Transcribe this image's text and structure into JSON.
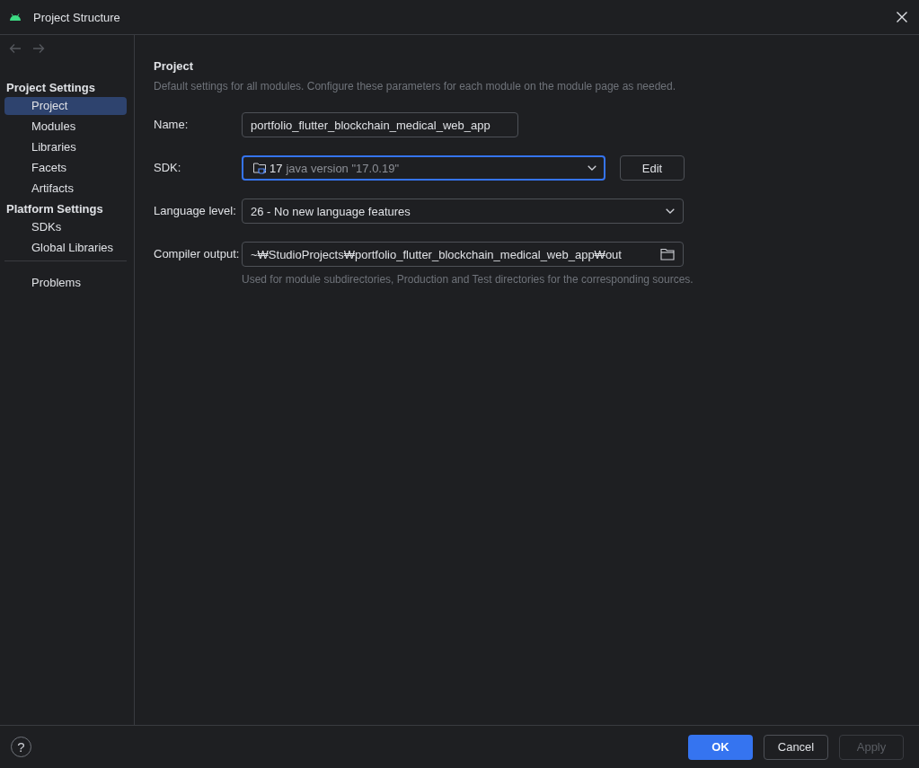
{
  "window": {
    "title": "Project Structure"
  },
  "navigation": [
    {
      "kind": "back",
      "disabled": true
    },
    {
      "kind": "forward",
      "disabled": true
    }
  ],
  "sidebar": {
    "groups": [
      {
        "heading": "Project Settings",
        "items": [
          {
            "label": "Project",
            "selected": true
          },
          {
            "label": "Modules",
            "selected": false
          },
          {
            "label": "Libraries",
            "selected": false
          },
          {
            "label": "Facets",
            "selected": false
          },
          {
            "label": "Artifacts",
            "selected": false
          }
        ]
      },
      {
        "heading": "Platform Settings",
        "items": [
          {
            "label": "SDKs",
            "selected": false
          },
          {
            "label": "Global Libraries",
            "selected": false
          }
        ]
      },
      {
        "items": [
          {
            "label": "Problems",
            "selected": false
          }
        ]
      }
    ]
  },
  "panel": {
    "title": "Project",
    "description": "Default settings for all modules. Configure these parameters for each module on the module page as needed.",
    "fields": [
      {
        "kind": "text",
        "label": "Name:",
        "value": "portfolio_flutter_blockchain_medical_web_app"
      },
      {
        "kind": "combo",
        "label": "SDK:",
        "value": "17",
        "detail": "java version \"17.0.19\"",
        "focused": true,
        "button": "Edit"
      },
      {
        "kind": "combo",
        "label": "Language level:",
        "value": "26 - No new language features",
        "focused": false
      },
      {
        "kind": "path",
        "label": "Compiler output:",
        "value": "~₩StudioProjects₩portfolio_flutter_blockchain_medical_web_app₩out",
        "hint": "Used for module subdirectories, Production and Test directories for the corresponding sources."
      }
    ]
  },
  "footer": {
    "help": "?",
    "buttons": [
      {
        "label": "OK",
        "kind": "primary",
        "disabled": false
      },
      {
        "label": "Cancel",
        "kind": "secondary",
        "disabled": false
      },
      {
        "label": "Apply",
        "kind": "secondary",
        "disabled": true
      }
    ]
  }
}
